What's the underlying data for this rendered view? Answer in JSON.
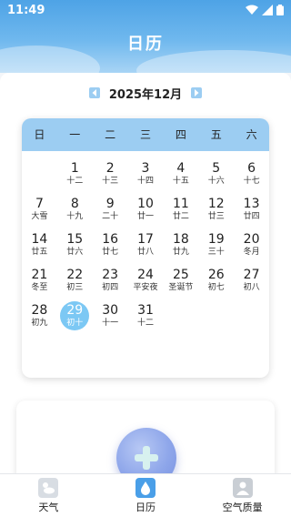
{
  "status": {
    "time": "11:49"
  },
  "header": {
    "title": "日历"
  },
  "month_nav": {
    "label": "2025年12月"
  },
  "weekdays": [
    "日",
    "一",
    "二",
    "三",
    "四",
    "五",
    "六"
  ],
  "weeks": [
    [
      null,
      {
        "d": "1",
        "l": "十二"
      },
      {
        "d": "2",
        "l": "十三"
      },
      {
        "d": "3",
        "l": "十四"
      },
      {
        "d": "4",
        "l": "十五"
      },
      {
        "d": "5",
        "l": "十六"
      },
      {
        "d": "6",
        "l": "十七"
      }
    ],
    [
      {
        "d": "7",
        "l": "大雪"
      },
      {
        "d": "8",
        "l": "十九"
      },
      {
        "d": "9",
        "l": "二十"
      },
      {
        "d": "10",
        "l": "廿一"
      },
      {
        "d": "11",
        "l": "廿二"
      },
      {
        "d": "12",
        "l": "廿三"
      },
      {
        "d": "13",
        "l": "廿四"
      }
    ],
    [
      {
        "d": "14",
        "l": "廿五"
      },
      {
        "d": "15",
        "l": "廿六"
      },
      {
        "d": "16",
        "l": "廿七"
      },
      {
        "d": "17",
        "l": "廿八"
      },
      {
        "d": "18",
        "l": "廿九"
      },
      {
        "d": "19",
        "l": "三十"
      },
      {
        "d": "20",
        "l": "冬月"
      }
    ],
    [
      {
        "d": "21",
        "l": "冬至"
      },
      {
        "d": "22",
        "l": "初三"
      },
      {
        "d": "23",
        "l": "初四"
      },
      {
        "d": "24",
        "l": "平安夜"
      },
      {
        "d": "25",
        "l": "圣诞节"
      },
      {
        "d": "26",
        "l": "初七"
      },
      {
        "d": "27",
        "l": "初八"
      }
    ],
    [
      {
        "d": "28",
        "l": "初九"
      },
      {
        "d": "29",
        "l": "初十",
        "selected": true
      },
      {
        "d": "30",
        "l": "十一"
      },
      {
        "d": "31",
        "l": "十二"
      },
      null,
      null,
      null
    ]
  ],
  "tabs": [
    {
      "label": "天气",
      "icon": "weather-icon"
    },
    {
      "label": "日历",
      "icon": "calendar-icon"
    },
    {
      "label": "空气质量",
      "icon": "air-quality-icon"
    }
  ],
  "colors": {
    "accent": "#9ccdf2",
    "selected": "#7cc8f4",
    "header": "#4ea3e6"
  }
}
